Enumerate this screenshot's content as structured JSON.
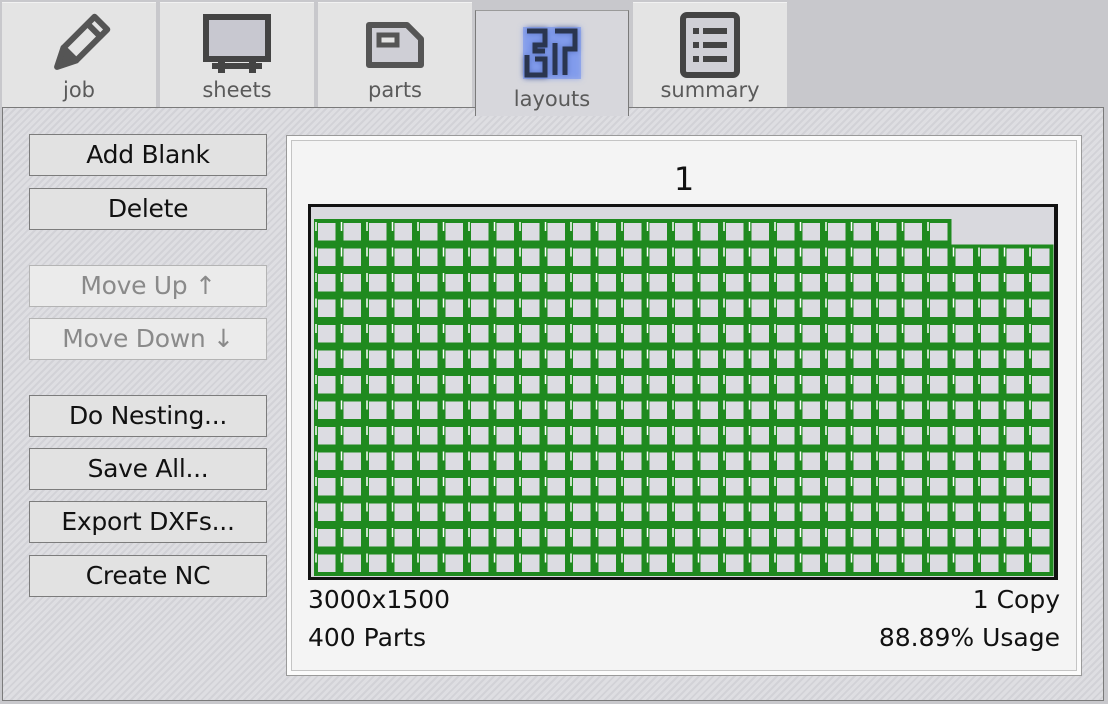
{
  "tabs": [
    {
      "label": "job",
      "icon": "pencil-icon"
    },
    {
      "label": "sheets",
      "icon": "sheet-icon"
    },
    {
      "label": "parts",
      "icon": "part-icon"
    },
    {
      "label": "layouts",
      "icon": "layouts-icon"
    },
    {
      "label": "summary",
      "icon": "list-icon"
    }
  ],
  "active_tab": "layouts",
  "buttons": {
    "add_blank": "Add Blank",
    "delete": "Delete",
    "move_up": "Move Up ↑",
    "move_down": "Move Down ↓",
    "do_nesting": "Do Nesting...",
    "save_all": "Save All...",
    "export_dxfs": "Export DXFs...",
    "create_nc": "Create NC"
  },
  "layout": {
    "number": "1",
    "sheet_size": "3000x1500",
    "copies": "1 Copy",
    "parts": "400 Parts",
    "usage": "88.89% Usage",
    "nest_grid": {
      "columns": 29,
      "rows": 14,
      "short_columns_from": 25
    },
    "colors": {
      "part_outline": "#1f8a1f",
      "sheet_fill": "#d9d9de",
      "accent": "#3a7bff"
    }
  }
}
